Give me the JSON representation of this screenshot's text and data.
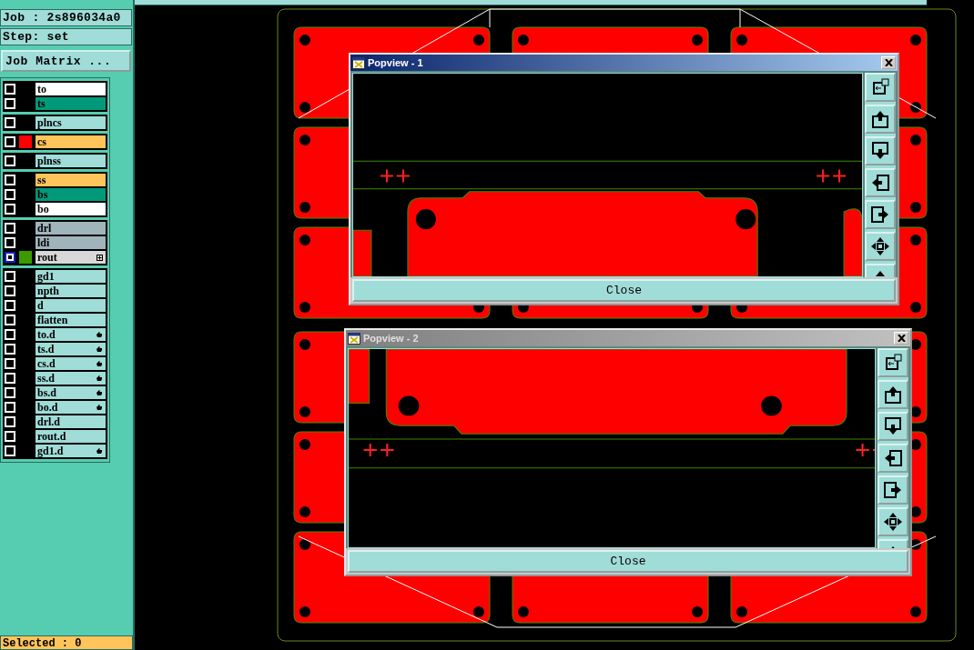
{
  "job_panel": {
    "job_label": "Job : 2s896034a0",
    "step_label": "Step: set",
    "job_matrix_button": "Job Matrix ..."
  },
  "layer_groups": [
    {
      "layers": [
        {
          "name": "to",
          "kind": "silk",
          "active": false,
          "affected": false,
          "attributes": false
        },
        {
          "name": "ts",
          "kind": "mask",
          "active": false,
          "affected": false,
          "attributes": false
        }
      ]
    },
    {
      "layers": [
        {
          "name": "plncs",
          "kind": "doc",
          "active": false,
          "affected": false,
          "attributes": false
        }
      ]
    },
    {
      "layers": [
        {
          "name": "cs",
          "kind": "signal",
          "color": "#ff0000",
          "active": false,
          "affected": false,
          "attributes": false
        }
      ]
    },
    {
      "layers": [
        {
          "name": "plnss",
          "kind": "doc",
          "active": false,
          "affected": false,
          "attributes": false
        }
      ]
    },
    {
      "layers": [
        {
          "name": "ss",
          "kind": "signal",
          "active": false,
          "affected": false,
          "attributes": false
        },
        {
          "name": "bs",
          "kind": "mask",
          "active": false,
          "affected": false,
          "attributes": false
        },
        {
          "name": "bo",
          "kind": "silk",
          "active": false,
          "affected": false,
          "attributes": false
        }
      ]
    },
    {
      "layers": [
        {
          "name": "drl",
          "kind": "drill",
          "active": false,
          "affected": false,
          "attributes": false
        },
        {
          "name": "ldi",
          "kind": "drill",
          "active": false,
          "affected": false,
          "attributes": false
        },
        {
          "name": "rout",
          "kind": "rout",
          "color": "#3c9a00",
          "active": true,
          "affected": false,
          "attributes": true
        }
      ]
    },
    {
      "layers": [
        {
          "name": "gd1",
          "kind": "doc",
          "active": false,
          "affected": false,
          "attributes": false
        },
        {
          "name": "npth",
          "kind": "doc",
          "active": false,
          "affected": false,
          "attributes": false
        },
        {
          "name": "d",
          "kind": "doc",
          "active": false,
          "affected": false,
          "attributes": false
        },
        {
          "name": "flatten",
          "kind": "doc",
          "active": false,
          "affected": false,
          "attributes": false
        },
        {
          "name": "to.d",
          "kind": "doc",
          "active": false,
          "affected": true,
          "attributes": false
        },
        {
          "name": "ts.d",
          "kind": "doc",
          "active": false,
          "affected": true,
          "attributes": false
        },
        {
          "name": "cs.d",
          "kind": "doc",
          "active": false,
          "affected": true,
          "attributes": false
        },
        {
          "name": "ss.d",
          "kind": "doc",
          "active": false,
          "affected": true,
          "attributes": false
        },
        {
          "name": "bs.d",
          "kind": "doc",
          "active": false,
          "affected": true,
          "attributes": false
        },
        {
          "name": "bo.d",
          "kind": "doc",
          "active": false,
          "affected": true,
          "attributes": false
        },
        {
          "name": "drl.d",
          "kind": "doc",
          "active": false,
          "affected": false,
          "attributes": false
        },
        {
          "name": "rout.d",
          "kind": "doc",
          "active": false,
          "affected": false,
          "attributes": false
        },
        {
          "name": "gd1.d",
          "kind": "doc",
          "active": false,
          "affected": true,
          "attributes": false
        }
      ]
    }
  ],
  "status_bar": {
    "selected_count": "Selected : 0"
  },
  "popviews": [
    {
      "title": "Popview - 1",
      "active": true,
      "close_button": "Close"
    },
    {
      "title": "Popview - 2",
      "active": false,
      "close_button": "Close"
    }
  ]
}
